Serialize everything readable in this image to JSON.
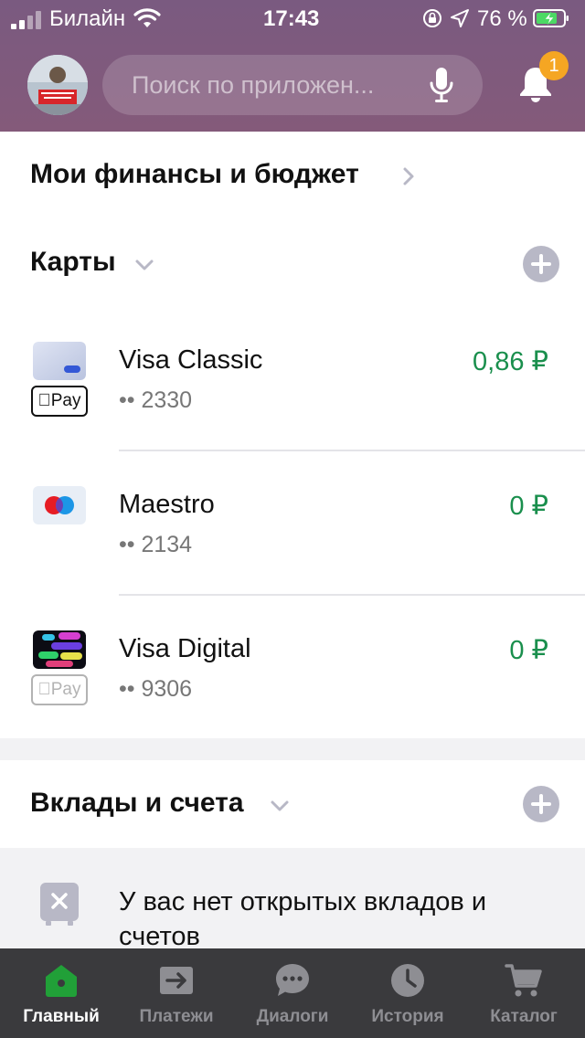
{
  "status_bar": {
    "carrier": "Билайн",
    "time": "17:43",
    "battery_percent": "76 %",
    "signal_bars": 2
  },
  "header": {
    "search_placeholder": "Поиск по приложен...",
    "notifications_count": "1",
    "colors": {
      "header_bg": "#7a5a80",
      "badge": "#f5a623"
    }
  },
  "finances": {
    "title": "Мои финансы и бюджет"
  },
  "cards": {
    "title": "Карты",
    "items": [
      {
        "name": "Visa Classic",
        "number": "•• 2330",
        "amount": "0,86 ₽",
        "apple_pay": "Pay",
        "apple_pay_active": true
      },
      {
        "name": "Maestro",
        "number": "•• 2134",
        "amount": "0 ₽"
      },
      {
        "name": "Visa Digital",
        "number": "•• 9306",
        "amount": "0 ₽",
        "apple_pay": "Pay",
        "apple_pay_active": false
      }
    ],
    "amount_color": "#1a8f4d"
  },
  "deposits": {
    "title": "Вклады и счета",
    "empty_text": "У вас нет открытых вкладов и счетов"
  },
  "tabbar": {
    "items": [
      {
        "label": "Главный",
        "icon": "home-icon",
        "active": true
      },
      {
        "label": "Платежи",
        "icon": "transfer-icon",
        "active": false
      },
      {
        "label": "Диалоги",
        "icon": "chat-icon",
        "active": false
      },
      {
        "label": "История",
        "icon": "clock-icon",
        "active": false
      },
      {
        "label": "Каталог",
        "icon": "cart-icon",
        "active": false
      }
    ],
    "active_color": "#21a038"
  }
}
